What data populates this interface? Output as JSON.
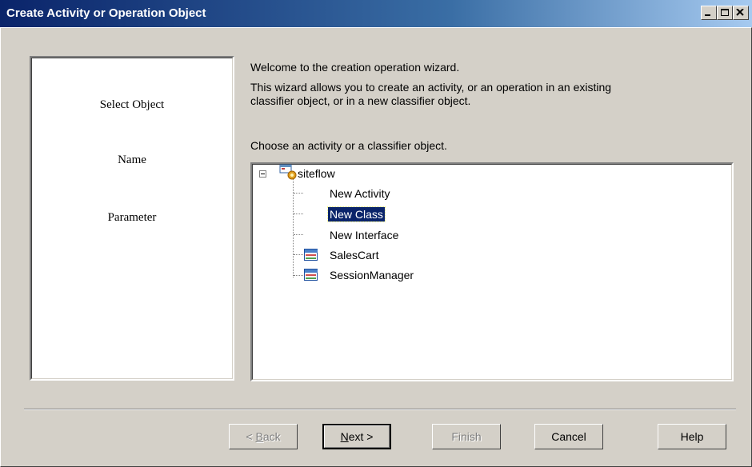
{
  "window": {
    "title": "Create Activity or Operation Object",
    "controls": [
      "minimize-icon",
      "maximize-icon",
      "close-icon"
    ]
  },
  "steps": [
    "Select Object",
    "Name",
    "Parameter"
  ],
  "intro": {
    "line1": "Welcome to the creation operation wizard.",
    "line2": "This wizard allows you to create an activity, or an operation in an existing",
    "line3": "classifier object, or in a new classifier object.",
    "prompt": "Choose an activity or a classifier object."
  },
  "tree": {
    "root": {
      "label": "siteflow",
      "icon": "package-icon",
      "expanded": true
    },
    "items": [
      {
        "label": "New Activity",
        "icon": "",
        "selected": false
      },
      {
        "label": "New Class",
        "icon": "",
        "selected": true
      },
      {
        "label": "New Interface",
        "icon": "",
        "selected": false
      },
      {
        "label": "SalesCart",
        "icon": "class-icon",
        "selected": false
      },
      {
        "label": "SessionManager",
        "icon": "class-icon",
        "selected": false
      }
    ]
  },
  "buttons": {
    "back": {
      "prefix": "< ",
      "mnemonic": "B",
      "rest": "ack",
      "enabled": false
    },
    "next": {
      "mnemonic": "N",
      "rest": "ext >",
      "enabled": true
    },
    "finish": {
      "label": "Finish",
      "enabled": false
    },
    "cancel": {
      "label": "Cancel",
      "enabled": true
    },
    "help": {
      "label": "Help",
      "enabled": true
    }
  },
  "colors": {
    "titlebar_start": "#0a246a",
    "titlebar_end": "#a6caf0",
    "face": "#d4d0c8",
    "selection": "#0a246a"
  }
}
